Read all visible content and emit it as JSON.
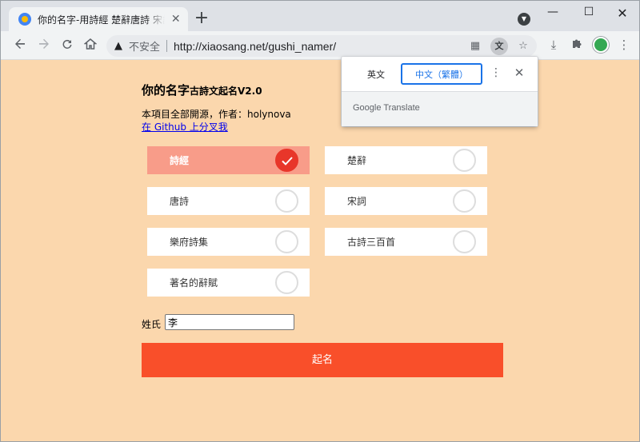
{
  "browser": {
    "tab_title": "你的名字-用詩經 楚辭唐詩 宋詞起名",
    "tab_close": "✕",
    "new_tab": "+",
    "security_label": "不安全",
    "url": "http://xiaosang.net/gushi_namer/",
    "window_controls": {
      "minimize": "—",
      "maximize": "☐",
      "close": "✕"
    }
  },
  "icons": {
    "back": "arrow-left-icon",
    "forward": "arrow-right-icon",
    "reload": "reload-icon",
    "home": "home-icon",
    "warning": "warning-icon",
    "apps": "apps-grid-icon",
    "translate": "translate-icon",
    "bookmark": "star-icon",
    "download": "download-icon",
    "extensions": "puzzle-icon",
    "menu": "kebab-menu-icon"
  },
  "translate_popup": {
    "lang_source": "英文",
    "lang_target": "中文（繁體）",
    "more": "⋮",
    "close": "✕",
    "footer_google": "Google",
    "footer_translate": "Translate"
  },
  "page": {
    "title_main": "你的名字",
    "title_small": "古詩文起名V2.0",
    "subtitle": "本項目全部開源，作者：holynova",
    "github_link": "在 Github 上分叉我",
    "options": [
      {
        "label": "詩經",
        "selected": true
      },
      {
        "label": "楚辭",
        "selected": false
      },
      {
        "label": "唐詩",
        "selected": false
      },
      {
        "label": "宋詞",
        "selected": false
      },
      {
        "label": "樂府詩集",
        "selected": false
      },
      {
        "label": "古詩三百首",
        "selected": false
      },
      {
        "label": "著名的辭賦",
        "selected": false
      }
    ],
    "surname_label": "姓氏",
    "surname_value": "李",
    "submit_label": "起名"
  },
  "colors": {
    "page_bg": "#fbd7ad",
    "selected_bg": "#f89c89",
    "check_red": "#e8362a",
    "submit_bg": "#f94f2a",
    "translate_accent": "#1a73e8"
  }
}
